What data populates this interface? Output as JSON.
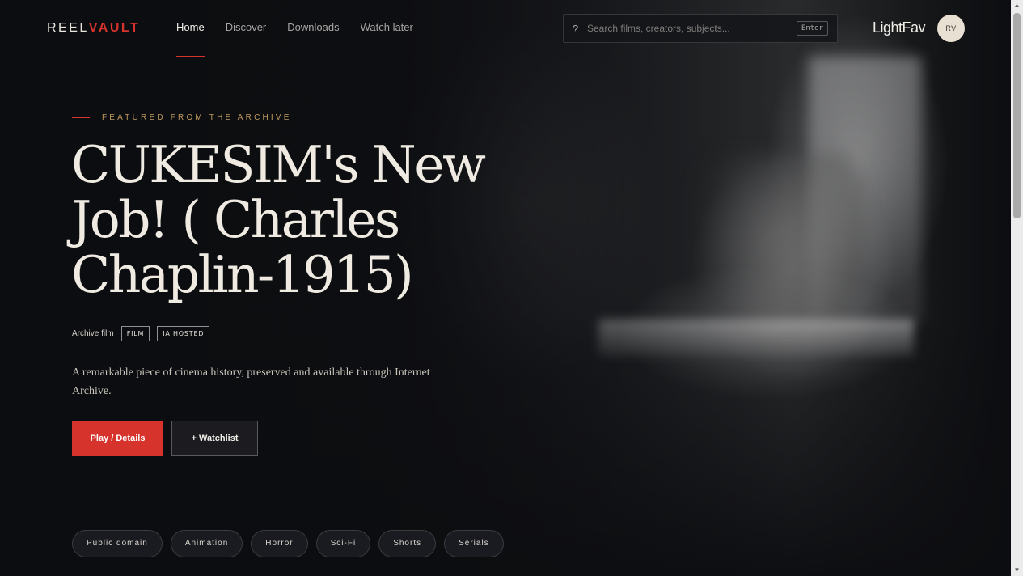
{
  "brand": {
    "part1": "REEL",
    "part2": "VAULT",
    "accent_color": "#d6332c"
  },
  "nav": {
    "items": [
      {
        "label": "Home",
        "active": true
      },
      {
        "label": "Discover",
        "active": false
      },
      {
        "label": "Downloads",
        "active": false
      },
      {
        "label": "Watch later",
        "active": false
      }
    ]
  },
  "search": {
    "placeholder": "Search films, creators, subjects...",
    "value": "",
    "key_hint": "Enter",
    "icon": "question-mark-icon"
  },
  "user": {
    "name": "LightFav",
    "initials": "RV"
  },
  "hero": {
    "eyebrow": "FEATURED FROM THE ARCHIVE",
    "title": "CUKESIM's New Job! ( Charles Chaplin-1915)",
    "type": "Archive film",
    "badges": [
      "FILM",
      "IA HOSTED"
    ],
    "description": "A remarkable piece of cinema history, preserved and available through Internet Archive.",
    "primary_button": "Play / Details",
    "secondary_button": "+ Watchlist"
  },
  "categories": [
    "Public domain",
    "Animation",
    "Horror",
    "Sci-Fi",
    "Shorts",
    "Serials"
  ],
  "scrollbar": {
    "up": "▲",
    "down": "▼"
  }
}
